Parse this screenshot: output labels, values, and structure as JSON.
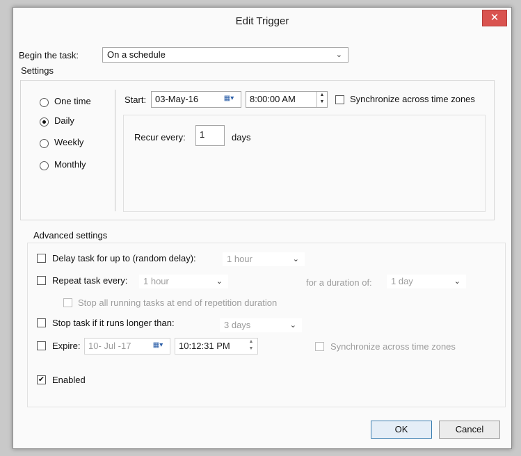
{
  "window": {
    "title": "Edit Trigger",
    "close_glyph": "✕"
  },
  "begin": {
    "label": "Begin the task:",
    "value": "On a schedule"
  },
  "settings": {
    "header": "Settings",
    "options": [
      {
        "label": "One time",
        "selected": false
      },
      {
        "label": "Daily",
        "selected": true
      },
      {
        "label": "Weekly",
        "selected": false
      },
      {
        "label": "Monthly",
        "selected": false
      }
    ],
    "start_label": "Start:",
    "start_date": "03-May-16",
    "start_time": "8:00:00 AM",
    "sync_label": "Synchronize across time zones",
    "sync_checked": false,
    "recur_label": "Recur every:",
    "recur_value": "1",
    "recur_unit": "days"
  },
  "advanced": {
    "header": "Advanced settings",
    "delay": {
      "label": "Delay task for up to (random delay):",
      "value": "1 hour",
      "checked": false
    },
    "repeat": {
      "label": "Repeat task every:",
      "value": "1 hour",
      "checked": false,
      "duration_label": "for a duration of:",
      "duration_value": "1 day"
    },
    "stop_all": {
      "label": "Stop all running tasks at end of repetition duration",
      "checked": false
    },
    "stop_longer": {
      "label": "Stop task if it runs longer than:",
      "value": "3 days",
      "checked": false
    },
    "expire": {
      "label": "Expire:",
      "date": "10- Jul -17",
      "time": "10:12:31 PM",
      "checked": false,
      "sync_label": "Synchronize across time zones"
    },
    "enabled": {
      "label": "Enabled",
      "checked": true,
      "check_glyph": "✔"
    }
  },
  "buttons": {
    "ok": "OK",
    "cancel": "Cancel"
  },
  "colors": {
    "close": "#d9534f",
    "default_button_border": "#3c7fb1"
  }
}
